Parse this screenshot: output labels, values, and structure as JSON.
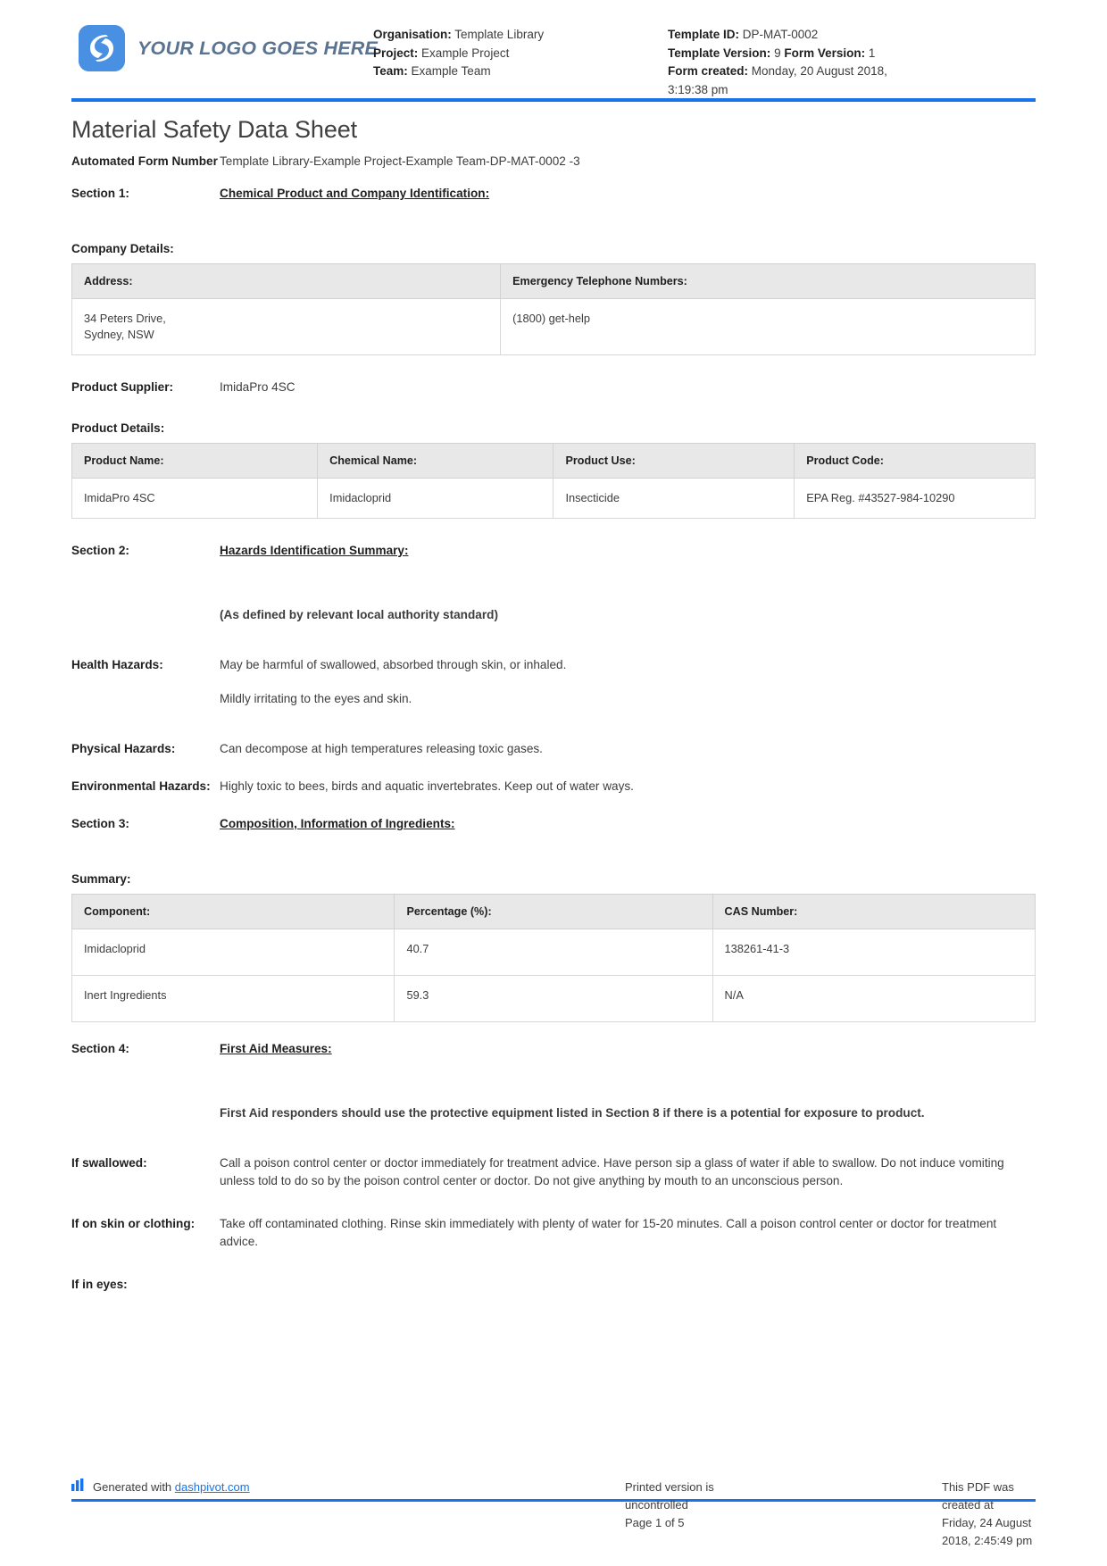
{
  "header": {
    "logo_text": "YOUR LOGO GOES HERE",
    "organisation_label": "Organisation:",
    "organisation_value": "Template Library",
    "project_label": "Project:",
    "project_value": "Example Project",
    "team_label": "Team:",
    "team_value": "Example Team",
    "template_id_label": "Template ID:",
    "template_id_value": "DP-MAT-0002",
    "template_version_label": "Template Version:",
    "template_version_value": "9",
    "form_version_label": "Form Version:",
    "form_version_value": "1",
    "form_created_label": "Form created:",
    "form_created_value": "Monday, 20 August 2018, 3:19:38 pm"
  },
  "document": {
    "title": "Material Safety Data Sheet",
    "automated_form_number_label": "Automated Form Number",
    "automated_form_number_value": "Template Library-Example Project-Example Team-DP-MAT-0002   -3"
  },
  "section1": {
    "label": "Section 1:",
    "heading": "Chemical Product and Company Identification:",
    "company_details_label": "Company Details:",
    "company_table": {
      "headers": [
        "Address:",
        "Emergency Telephone Numbers:"
      ],
      "rows": [
        [
          "34 Peters Drive,\nSydney, NSW",
          "(1800) get-help"
        ]
      ]
    },
    "product_supplier_label": "Product Supplier:",
    "product_supplier_value": "ImidaPro 4SC",
    "product_details_label": "Product Details:",
    "product_table": {
      "headers": [
        "Product Name:",
        "Chemical Name:",
        "Product Use:",
        "Product Code:"
      ],
      "rows": [
        [
          "ImidaPro 4SC",
          "Imidacloprid",
          "Insecticide",
          "EPA Reg. #43527-984-10290"
        ]
      ]
    }
  },
  "section2": {
    "label": "Section 2:",
    "heading": "Hazards Identification Summary:",
    "standard_note": "(As defined by relevant local authority standard)",
    "health_hazards_label": "Health Hazards:",
    "health_hazards_1": "May be harmful of swallowed, absorbed through skin, or inhaled.",
    "health_hazards_2": "Mildly irritating to the eyes and skin.",
    "physical_hazards_label": "Physical Hazards:",
    "physical_hazards_value": "Can decompose at high temperatures releasing toxic gases.",
    "environmental_hazards_label": "Environmental Hazards:",
    "environmental_hazards_value": "Highly toxic to bees, birds and aquatic invertebrates. Keep out of water ways."
  },
  "section3": {
    "label": "Section 3:",
    "heading": "Composition, Information of Ingredients:",
    "summary_label": "Summary:",
    "table": {
      "headers": [
        "Component:",
        "Percentage (%):",
        "CAS Number:"
      ],
      "rows": [
        [
          "Imidacloprid",
          "40.7",
          "138261-41-3"
        ],
        [
          "Inert Ingredients",
          "59.3",
          "N/A"
        ]
      ]
    }
  },
  "section4": {
    "label": "Section 4:",
    "heading": "First Aid Measures:",
    "responder_note": "First Aid responders should use the protective equipment listed in Section 8 if there is a potential for exposure to product.",
    "if_swallowed_label": "If swallowed:",
    "if_swallowed_value": "Call a poison control center or doctor immediately for treatment advice. Have person sip a glass of water if able to swallow. Do not induce vomiting unless told to do so by the poison control center or doctor. Do not give anything by mouth to an unconscious person.",
    "if_on_skin_label": "If on skin or clothing:",
    "if_on_skin_value": "Take off contaminated clothing. Rinse skin immediately with plenty of water for 15-20 minutes. Call a poison control center or doctor for treatment advice.",
    "if_in_eyes_label": "If in eyes:"
  },
  "footer": {
    "generated_prefix": "Generated with",
    "generated_link": "dashpivot.com",
    "uncontrolled_note": "Printed version is uncontrolled",
    "page_indicator": "Page 1 of 5",
    "pdf_created_note": "This PDF was created at",
    "pdf_created_date": "Friday, 24 August 2018, 2:45:49 pm"
  },
  "colors": {
    "accent": "#1a73e8",
    "logo_blue": "#4a90e2",
    "table_header": "#e8e8e8"
  }
}
